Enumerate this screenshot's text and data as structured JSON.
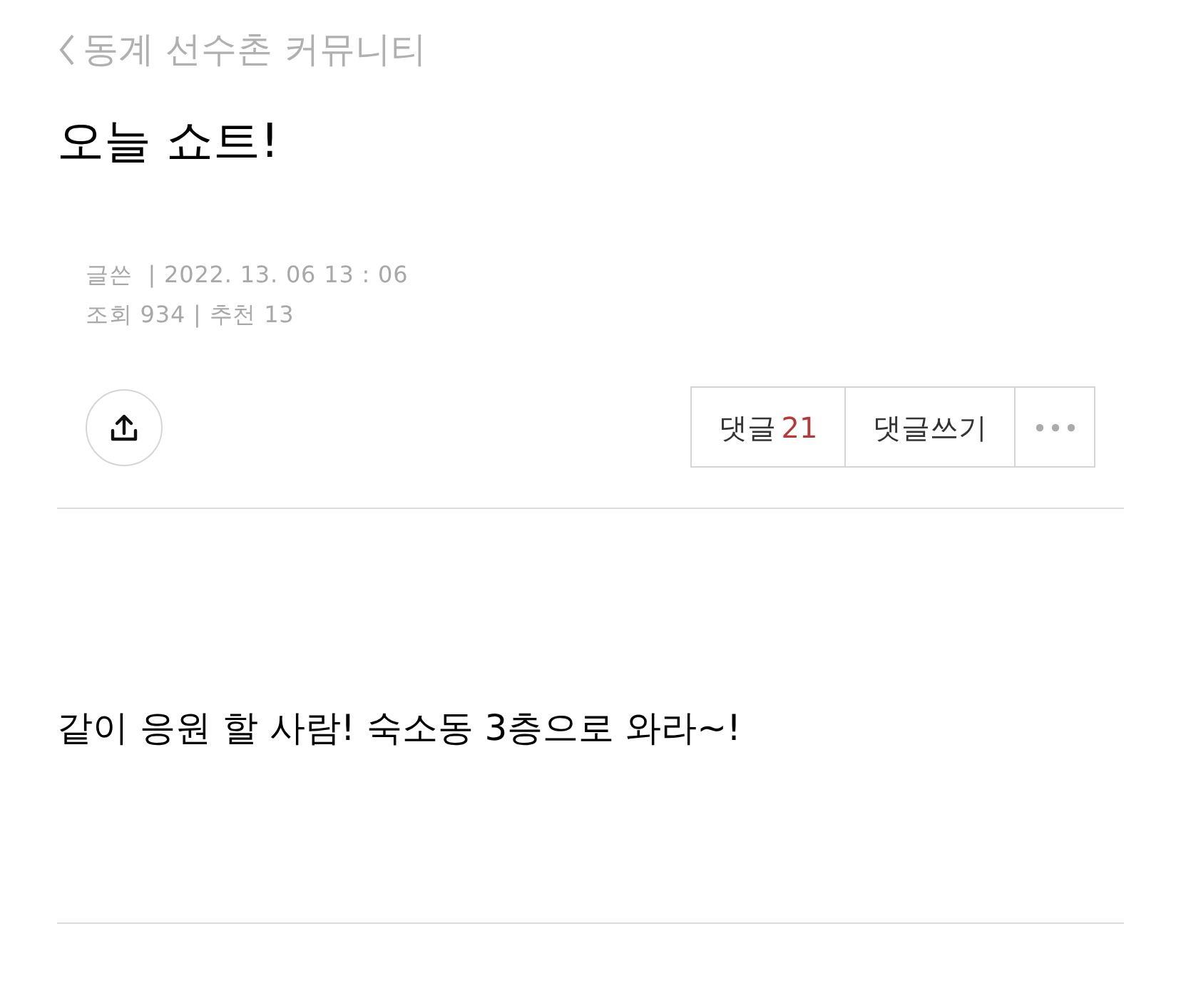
{
  "board": {
    "label": "동계 선수촌 커뮤니티"
  },
  "post": {
    "title": "오늘 쇼트!",
    "meta_lines": [
      "글쓴  | 2022. 13. 06 13 : 06",
      "조회 934 | 추천 13"
    ],
    "body": "같이 응원 할 사람! 숙소동 3층으로 와라~!"
  },
  "actions": {
    "comments_label": "댓글",
    "comments_count": "21",
    "write_comment": "댓글쓰기"
  }
}
